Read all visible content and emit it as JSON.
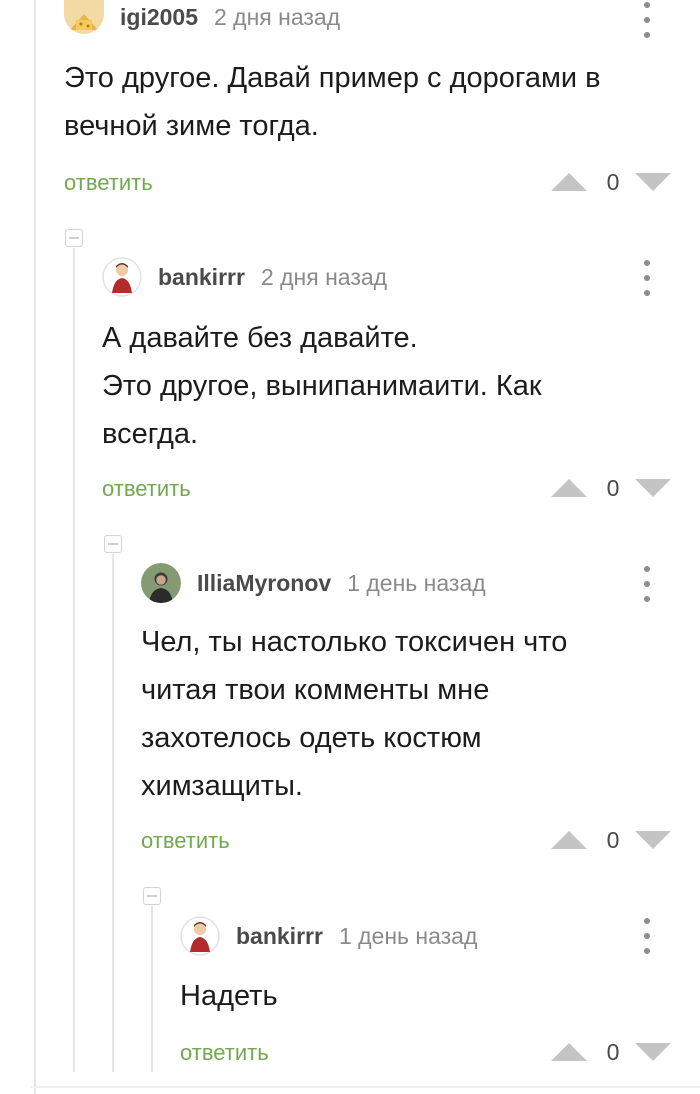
{
  "comments": [
    {
      "author": "igi2005",
      "time": "2 дня назад",
      "lines": [
        "Это другое. Давай пример с дорогами в",
        "вечной зиме тогда."
      ],
      "reply_label": "ответить",
      "score": "0"
    },
    {
      "author": "bankirrr",
      "time": "2 дня назад",
      "lines": [
        "А давайте без давайте.",
        "Это другое, вынипанимаити. Как",
        "всегда."
      ],
      "reply_label": "ответить",
      "score": "0"
    },
    {
      "author": "IlliaMyronov",
      "time": "1 день назад",
      "lines": [
        "Чел, ты настолько токсичен что",
        "читая твои комменты мне",
        "захотелось одеть костюм",
        "химзащиты."
      ],
      "reply_label": "ответить",
      "score": "0"
    },
    {
      "author": "bankirrr",
      "time": "1 день назад",
      "lines": [
        "Надеть"
      ],
      "reply_label": "ответить",
      "score": "0"
    }
  ],
  "icons": {
    "menu": "more-vertical-icon",
    "vote_up": "triangle-up-icon",
    "vote_down": "triangle-down-icon",
    "collapse": "collapse-minus-icon"
  },
  "colors": {
    "reply_link": "#72a84e",
    "vote_arrow": "#c4c4c4",
    "time_text": "#8a8a8a"
  }
}
